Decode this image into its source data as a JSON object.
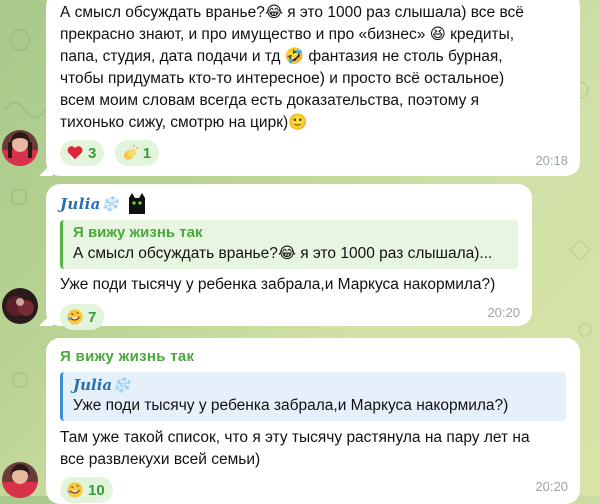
{
  "messages": [
    {
      "text": "А смысл обсуждать вранье?😂 я это 1000 раз слышала) все всё\nпрекрасно знают, и про имущество и про «бизнес» 😆 кредиты,\nпапа, студия, дата подачи и тд 🤣 фантазия не столь бурная,\nчтобы придумать кто-то интересное) и просто всё остальное)\nвсем моим словам всегда есть доказательства, поэтому я\nтихонько сижу, смотрю на цирк)🙂",
      "reactions": [
        {
          "icon": "heart-icon",
          "count": "3"
        },
        {
          "icon": "clapping-hands-icon",
          "count": "1"
        }
      ],
      "time": "20:18"
    },
    {
      "sender": "Julia❄️",
      "reply": {
        "author": "Я вижу жизнь так",
        "text": "А смысл обсуждать вранье?😂 я это 1000 раз слышала)..."
      },
      "text": "Уже поди тысячу у ребенка забрала,и Маркуса накормила?)",
      "reactions": [
        {
          "icon": "rofl-icon",
          "count": "7"
        }
      ],
      "time": "20:20"
    },
    {
      "sender": "Я вижу жизнь так",
      "reply": {
        "author": "Julia❄️",
        "text": "Уже поди тысячу у ребенка забрала,и Маркуса накормила?)"
      },
      "text": "Там уже такой список, что я эту тысячу растянула на пару лет на\nвсе развлекухи всей семьи)",
      "reactions": [
        {
          "icon": "rofl-icon",
          "count": "10"
        }
      ],
      "time": "20:20"
    }
  ],
  "colors": {
    "bubble": "#ffffff",
    "sender_julia": "#2a6fb0",
    "sender_green": "#4aa83c",
    "reaction_bg": "#e3f4dc",
    "reaction_text": "#3a9a3a",
    "timestamp": "#9aa6a0"
  }
}
